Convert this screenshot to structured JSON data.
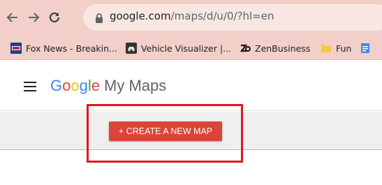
{
  "browser": {
    "url_host": "google.com",
    "url_path": "/maps/d/u/0/?hl=en"
  },
  "bookmarks": [
    {
      "label": "Fox News - Breakin...",
      "icon": "fox-news-icon"
    },
    {
      "label": "Vehicle Visualizer |...",
      "icon": "vehicle-icon"
    },
    {
      "label": "ZenBusiness",
      "icon": "zenbusiness-icon"
    },
    {
      "label": "Fun",
      "icon": "folder-icon"
    },
    {
      "label": "",
      "icon": "doc-icon"
    }
  ],
  "header": {
    "brand_letters": [
      "G",
      "o",
      "o",
      "g",
      "l",
      "e"
    ],
    "product": "My Maps"
  },
  "main": {
    "create_button_label": "+ CREATE A NEW MAP"
  },
  "colors": {
    "accent": "#db4437",
    "highlight": "#e2141d",
    "toolbar": "#f2cfc8"
  }
}
